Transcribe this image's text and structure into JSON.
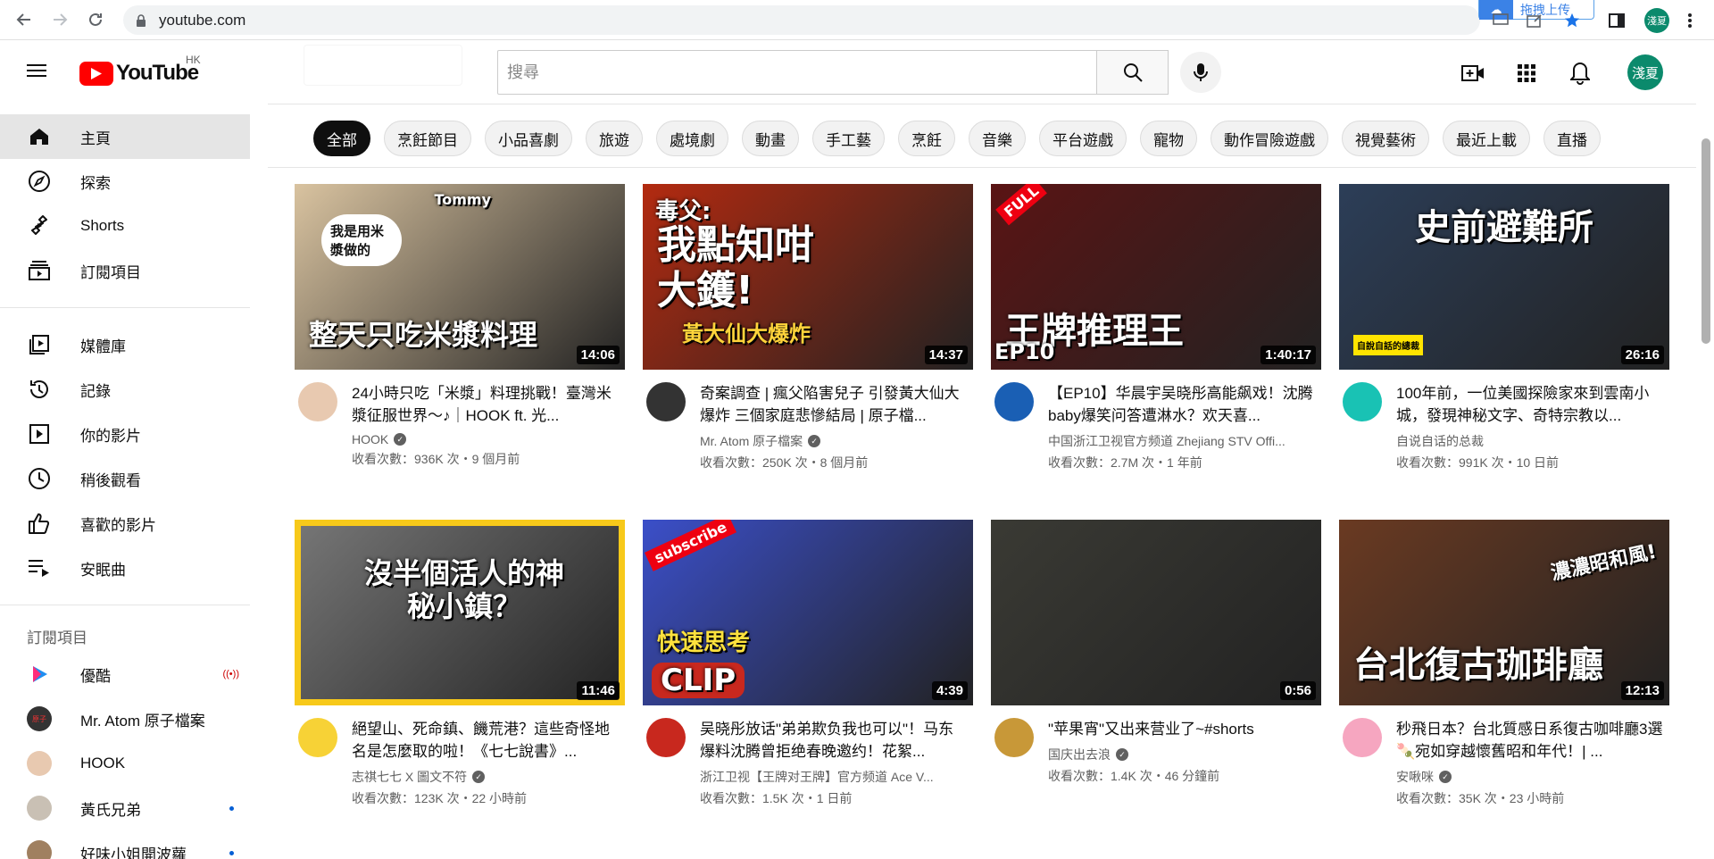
{
  "browser": {
    "url": "youtube.com",
    "extension_label": "拖拽上传",
    "avatar_text": "淺夏"
  },
  "header": {
    "logo_text": "YouTube",
    "region": "HK",
    "search_placeholder": "搜尋",
    "avatar_text": "淺夏"
  },
  "sidebar": {
    "items": [
      {
        "label": "主頁",
        "icon": "home-icon",
        "active": true
      },
      {
        "label": "探索",
        "icon": "explore-icon"
      },
      {
        "label": "Shorts",
        "icon": "shorts-icon"
      },
      {
        "label": "訂閱項目",
        "icon": "subscriptions-icon"
      }
    ],
    "library": [
      {
        "label": "媒體庫",
        "icon": "library-icon"
      },
      {
        "label": "記錄",
        "icon": "history-icon"
      },
      {
        "label": "你的影片",
        "icon": "your-videos-icon"
      },
      {
        "label": "稍後觀看",
        "icon": "watch-later-icon"
      },
      {
        "label": "喜歡的影片",
        "icon": "liked-icon"
      },
      {
        "label": "安眠曲",
        "icon": "playlist-icon"
      }
    ],
    "subscriptions_heading": "訂閱項目",
    "subscriptions": [
      {
        "label": "優酷",
        "color": "#1f8ef1",
        "badge": "live"
      },
      {
        "label": "Mr. Atom 原子檔案",
        "color": "#333333"
      },
      {
        "label": "HOOK",
        "color": "#e8c9b0"
      },
      {
        "label": "黃氏兄弟",
        "color": "#c9c0b4",
        "badge": "dot"
      },
      {
        "label": "好味小姐開波蘿",
        "color": "#a08060",
        "badge": "dot"
      }
    ]
  },
  "chips": [
    "全部",
    "烹飪節目",
    "小品喜劇",
    "旅遊",
    "處境劇",
    "動畫",
    "手工藝",
    "烹飪",
    "音樂",
    "平台遊戲",
    "寵物",
    "動作冒險遊戲",
    "視覺藝術",
    "最近上載",
    "直播"
  ],
  "videos": [
    {
      "thumb_text": "整天只吃米漿料理",
      "thumb_sub": "我是用米漿做的",
      "thumb_tag": "Tommy",
      "thumb_bg": "#d9c3a0",
      "duration": "14:06",
      "title": "24小時只吃「米漿」料理挑戰！臺灣米漿征服世界～♪｜HOOK ft. 光...",
      "channel": "HOOK",
      "verified": true,
      "stats": "收看次數：936K 次・9 個月前",
      "avatar_color": "#e8c9b0"
    },
    {
      "thumb_text": "我點知咁大鑊!",
      "thumb_sub": "毒父:",
      "thumb_tag": "黃大仙大爆炸",
      "thumb_bg": "#b32a10",
      "duration": "14:37",
      "title": "奇案調查 | 瘋父陷害兒子 引發黃大仙大爆炸 三個家庭悲慘結局 | 原子檔...",
      "channel": "Mr. Atom 原子檔案",
      "verified": true,
      "stats": "收看次數：250K 次・8 個月前",
      "avatar_color": "#333333"
    },
    {
      "thumb_text": "王牌推理王",
      "thumb_sub": "EP10",
      "thumb_tag": "FULL",
      "thumb_bg": "#5a1414",
      "duration": "1:40:17",
      "title": "【EP10】华晨宇吴晓彤高能飙戏！沈腾baby爆笑问答遭淋水？欢天喜...",
      "channel": "中国浙江卫视官方频道 Zhejiang STV Offi...",
      "verified": false,
      "stats": "收看次數：2.7M 次・1 年前",
      "avatar_color": "#1a5fb4"
    },
    {
      "thumb_text": "史前避難所",
      "thumb_sub": "自說自話的總裁",
      "thumb_tag": "",
      "thumb_bg": "#2c3e58",
      "duration": "26:16",
      "title": "100年前，一位美國探險家來到雲南小城，發現神秘文字、奇特宗教以...",
      "channel": "自说自话的总裁",
      "verified": false,
      "stats": "收看次數：991K 次・10 日前",
      "avatar_color": "#19c2b4"
    },
    {
      "thumb_text": "沒半個活人的神秘小鎮？",
      "thumb_sub": "",
      "thumb_tag": "",
      "thumb_bg": "#777777",
      "duration": "11:46",
      "title": "絕望山、死命鎮、饑荒港？這些奇怪地名是怎麼取的啦！《七七說書》...",
      "channel": "志祺七七 X 圖文不符",
      "verified": true,
      "stats": "收看次數：123K 次・22 小時前",
      "avatar_color": "#f7d236"
    },
    {
      "thumb_text": "快速思考",
      "thumb_sub": "CLIP",
      "thumb_tag": "subscribe",
      "thumb_bg": "#3b4fc9",
      "duration": "4:39",
      "title": "吴晓彤放话\"弟弟欺负我也可以\"！马东爆料沈腾曾拒绝春晚邀约！花絮...",
      "channel": "浙江卫视【王牌对王牌】官方频道 Ace V...",
      "verified": false,
      "stats": "收看次數：1.5K 次・1 日前",
      "avatar_color": "#c8281e"
    },
    {
      "thumb_text": "",
      "thumb_sub": "",
      "thumb_tag": "",
      "thumb_bg": "#3a3a34",
      "duration": "0:56",
      "title": "\"苹果宵\"又出来营业了~#shorts",
      "channel": "国庆出去浪",
      "verified": true,
      "stats": "收看次數：1.4K 次・46 分鐘前",
      "avatar_color": "#c89838"
    },
    {
      "thumb_text": "台北復古珈琲廳",
      "thumb_sub": "濃濃昭和風!",
      "thumb_tag": "",
      "thumb_bg": "#6a3a22",
      "duration": "12:13",
      "title": "秒飛日本？台北質感日系復古咖啡廳3選🍡宛如穿越懷舊昭和年代！| ...",
      "channel": "安啾咪",
      "verified": true,
      "stats": "收看次數：35K 次・23 小時前",
      "avatar_color": "#f6a6c0"
    }
  ]
}
